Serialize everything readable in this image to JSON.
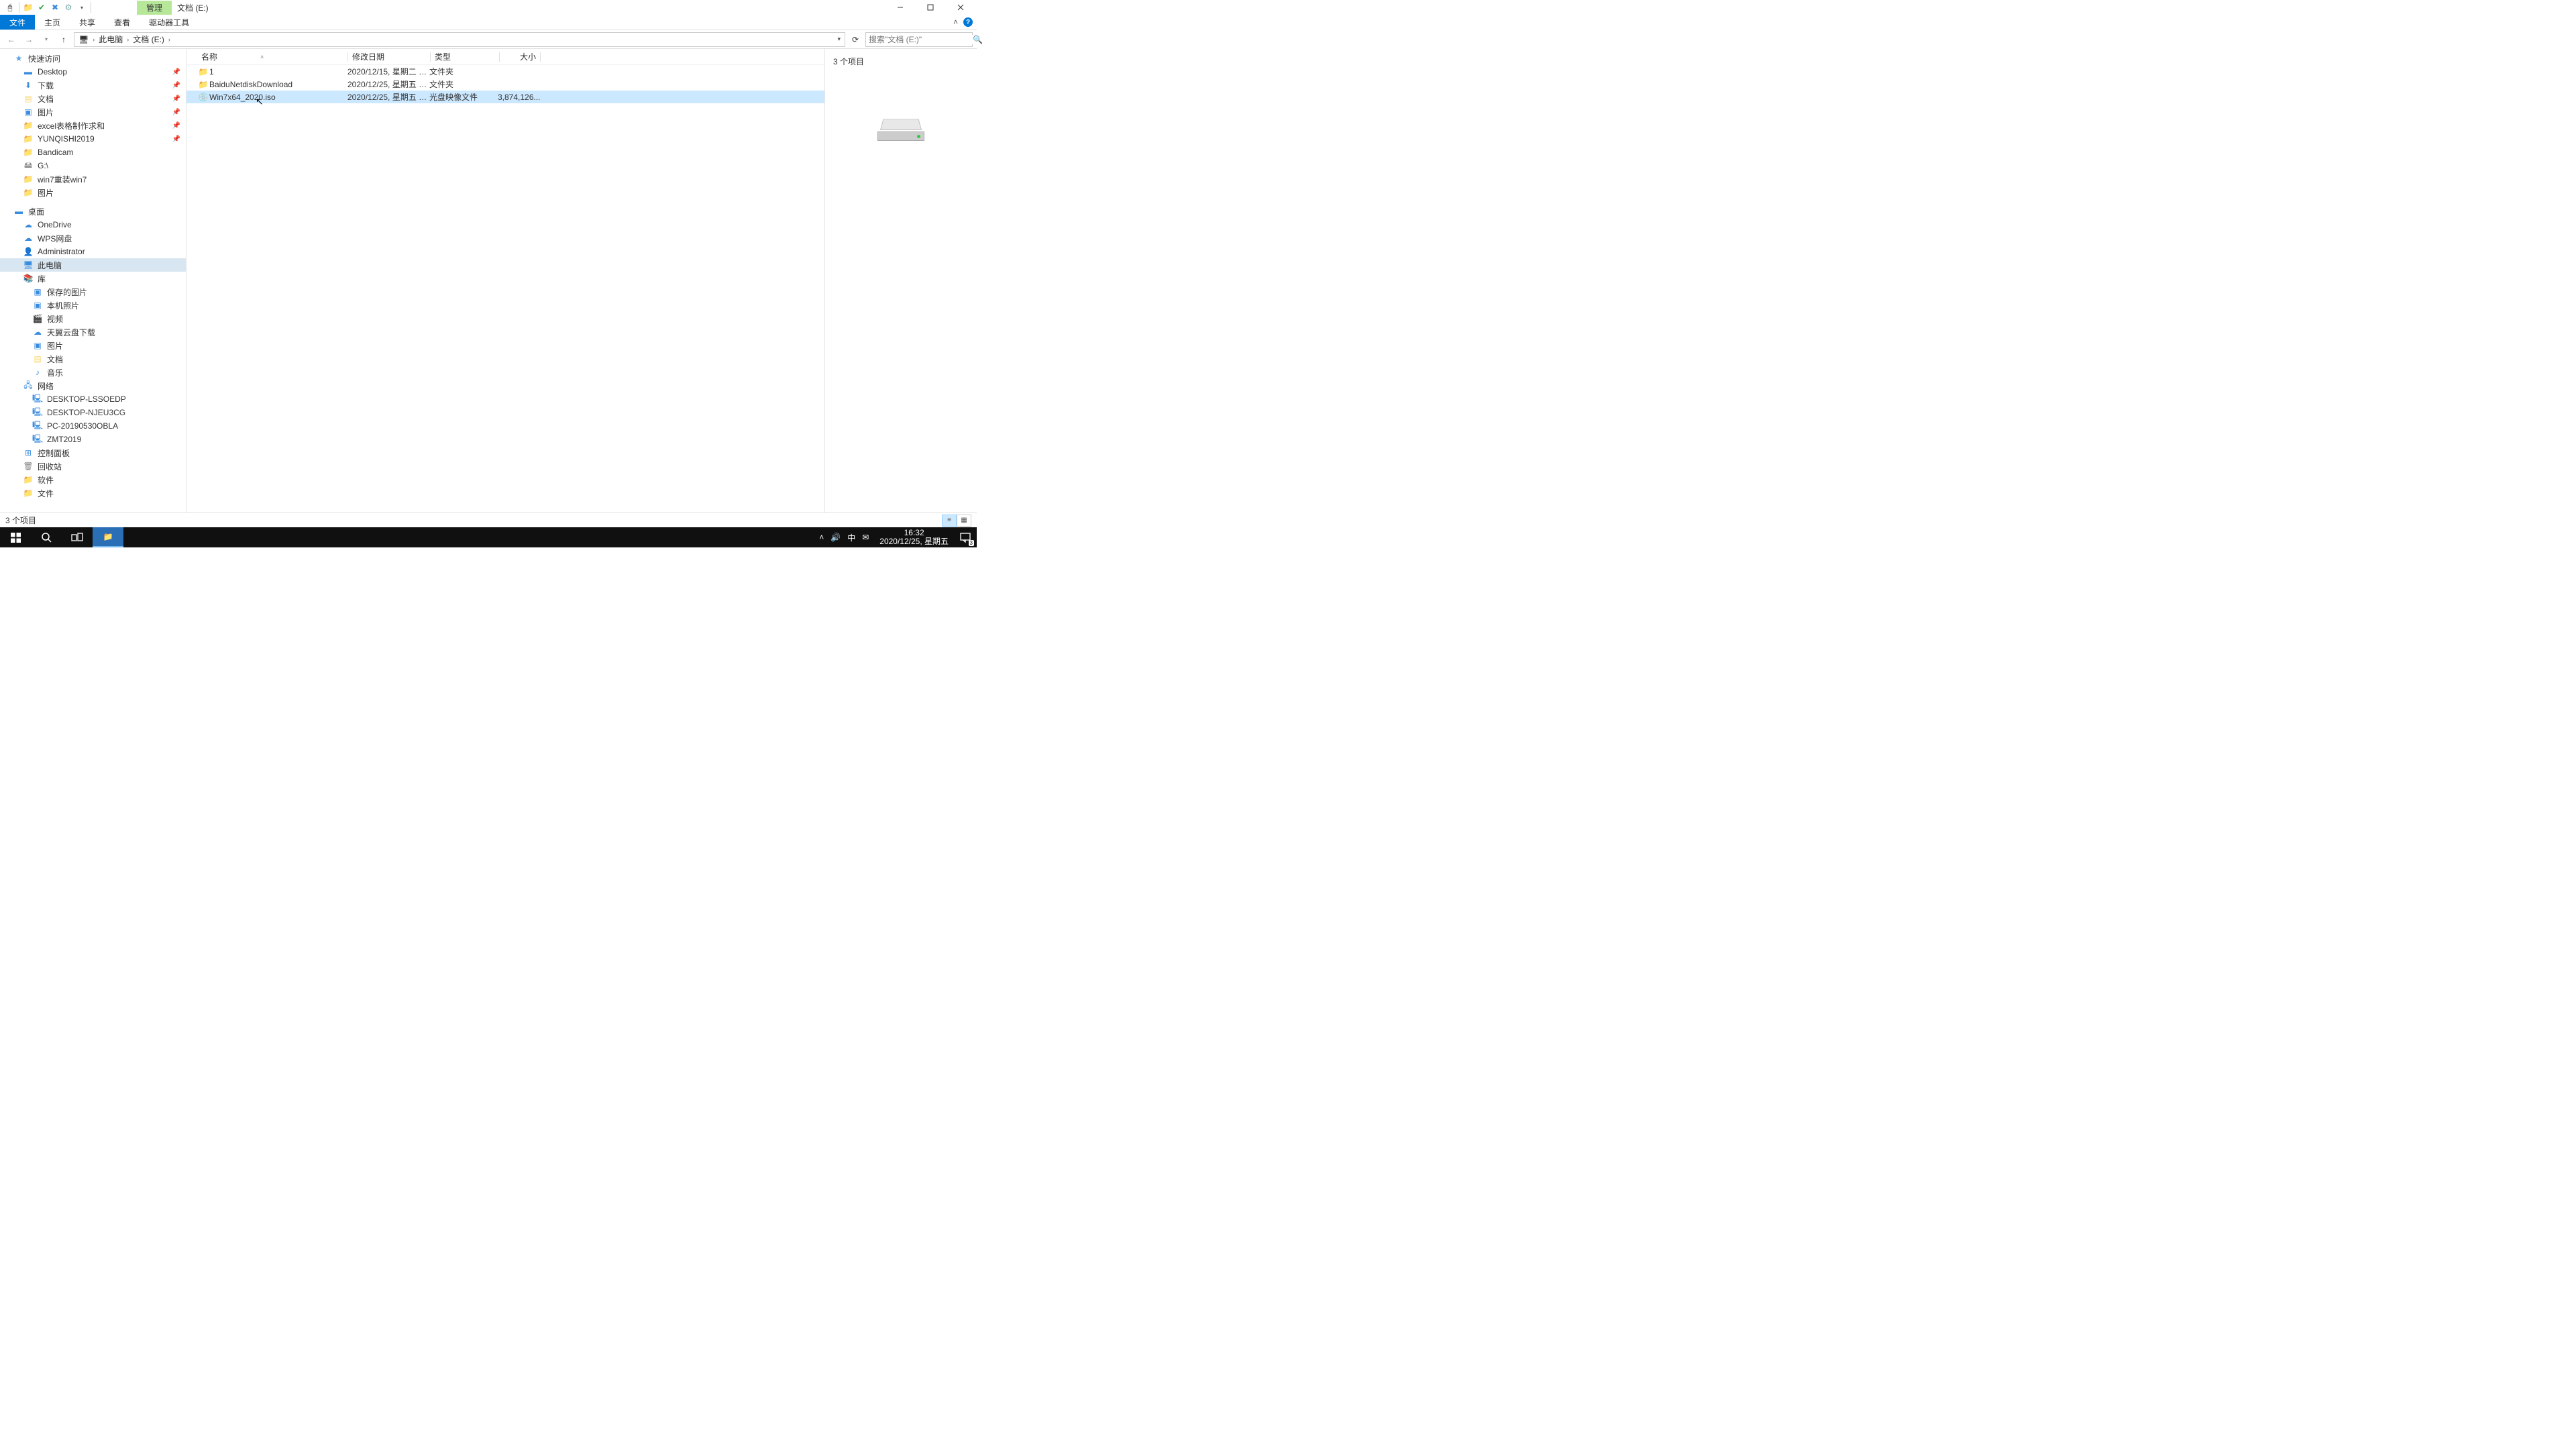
{
  "titlebar": {
    "context_tab": "管理",
    "window_title": "文档 (E:)"
  },
  "ribbon": {
    "file": "文件",
    "home": "主页",
    "share": "共享",
    "view": "查看",
    "drive_tools": "驱动器工具"
  },
  "address": {
    "segments": [
      "此电脑",
      "文档 (E:)"
    ],
    "search_placeholder": "搜索\"文档 (E:)\""
  },
  "nav": {
    "quick_access": "快速访问",
    "quick_items": [
      {
        "label": "Desktop",
        "pinned": true
      },
      {
        "label": "下载",
        "pinned": true
      },
      {
        "label": "文档",
        "pinned": true
      },
      {
        "label": "图片",
        "pinned": true
      },
      {
        "label": "excel表格制作求和",
        "pinned": true
      },
      {
        "label": "YUNQISHI2019",
        "pinned": true
      },
      {
        "label": "Bandicam",
        "pinned": false
      },
      {
        "label": "G:\\",
        "pinned": false
      },
      {
        "label": "win7重装win7",
        "pinned": false
      },
      {
        "label": "图片",
        "pinned": false
      }
    ],
    "desktop_group": "桌面",
    "desktop_items": [
      "OneDrive",
      "WPS网盘",
      "Administrator",
      "此电脑",
      "库"
    ],
    "library_items": [
      "保存的图片",
      "本机照片",
      "视频",
      "天翼云盘下载",
      "图片",
      "文档",
      "音乐"
    ],
    "network": "网络",
    "network_items": [
      "DESKTOP-LSSOEDP",
      "DESKTOP-NJEU3CG",
      "PC-20190530OBLA",
      "ZMT2019"
    ],
    "control_panel": "控制面板",
    "recycle_bin": "回收站",
    "software": "软件",
    "docs": "文件"
  },
  "columns": {
    "name": "名称",
    "date": "修改日期",
    "type": "类型",
    "size": "大小"
  },
  "files": [
    {
      "name": "1",
      "date": "2020/12/15, 星期二 1...",
      "type": "文件夹",
      "size": "",
      "icon": "folder",
      "selected": false
    },
    {
      "name": "BaiduNetdiskDownload",
      "date": "2020/12/25, 星期五 1...",
      "type": "文件夹",
      "size": "",
      "icon": "folder",
      "selected": false
    },
    {
      "name": "Win7x64_2020.iso",
      "date": "2020/12/25, 星期五 1...",
      "type": "光盘映像文件",
      "size": "3,874,126...",
      "icon": "iso",
      "selected": true
    }
  ],
  "preview": {
    "item_count": "3 个项目"
  },
  "statusbar": {
    "text": "3 个项目"
  },
  "taskbar": {
    "time": "16:32",
    "date": "2020/12/25, 星期五",
    "ime": "中",
    "notif_count": "3"
  }
}
